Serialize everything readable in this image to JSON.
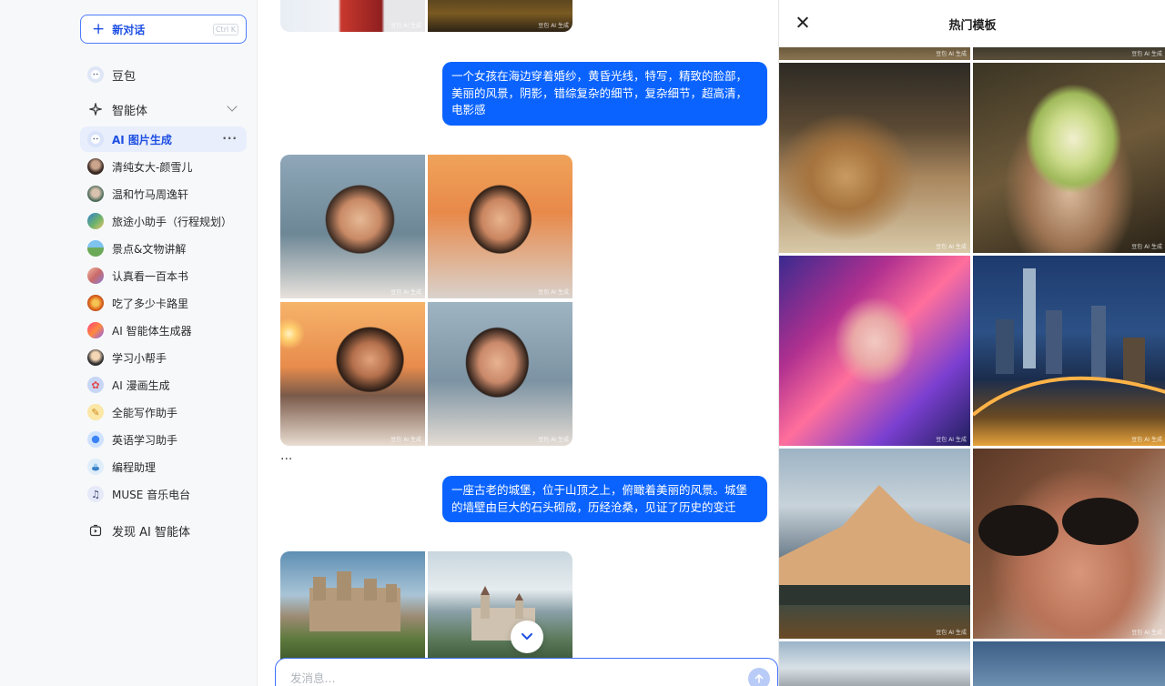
{
  "sidebar": {
    "new_chat": {
      "label": "新对话",
      "shortcut": "Ctrl K"
    },
    "doubao": "豆包",
    "agents_section": "智能体",
    "active_more": "···",
    "items": [
      "AI 图片生成",
      "清纯女大-颜雪儿",
      "温和竹马周逸轩",
      "旅途小助手（行程规划）",
      "景点&文物讲解",
      "认真看一百本书",
      "吃了多少卡路里",
      "AI 智能体生成器",
      "学习小帮手",
      "AI 漫画生成",
      "全能写作助手",
      "英语学习助手",
      "编程助理",
      "MUSE 音乐电台"
    ],
    "discover": "发现 AI 智能体"
  },
  "chat": {
    "watermark": "豆包 AI 生成",
    "messages": [
      "一个女孩在海边穿着婚纱，黄昏光线，特写，精致的脸部，美丽的风景，阴影，错综复杂的细节，复杂细节，超高清，电影感",
      "一座古老的城堡，位于山顶之上，俯瞰着美丽的风景。城堡的墙壁由巨大的石头砌成，历经沧桑，见证了历史的变迁"
    ],
    "ellipsis": "···",
    "input_placeholder": "发消息..."
  },
  "panel": {
    "title": "热门模板",
    "watermark": "豆包 AI 生成"
  }
}
